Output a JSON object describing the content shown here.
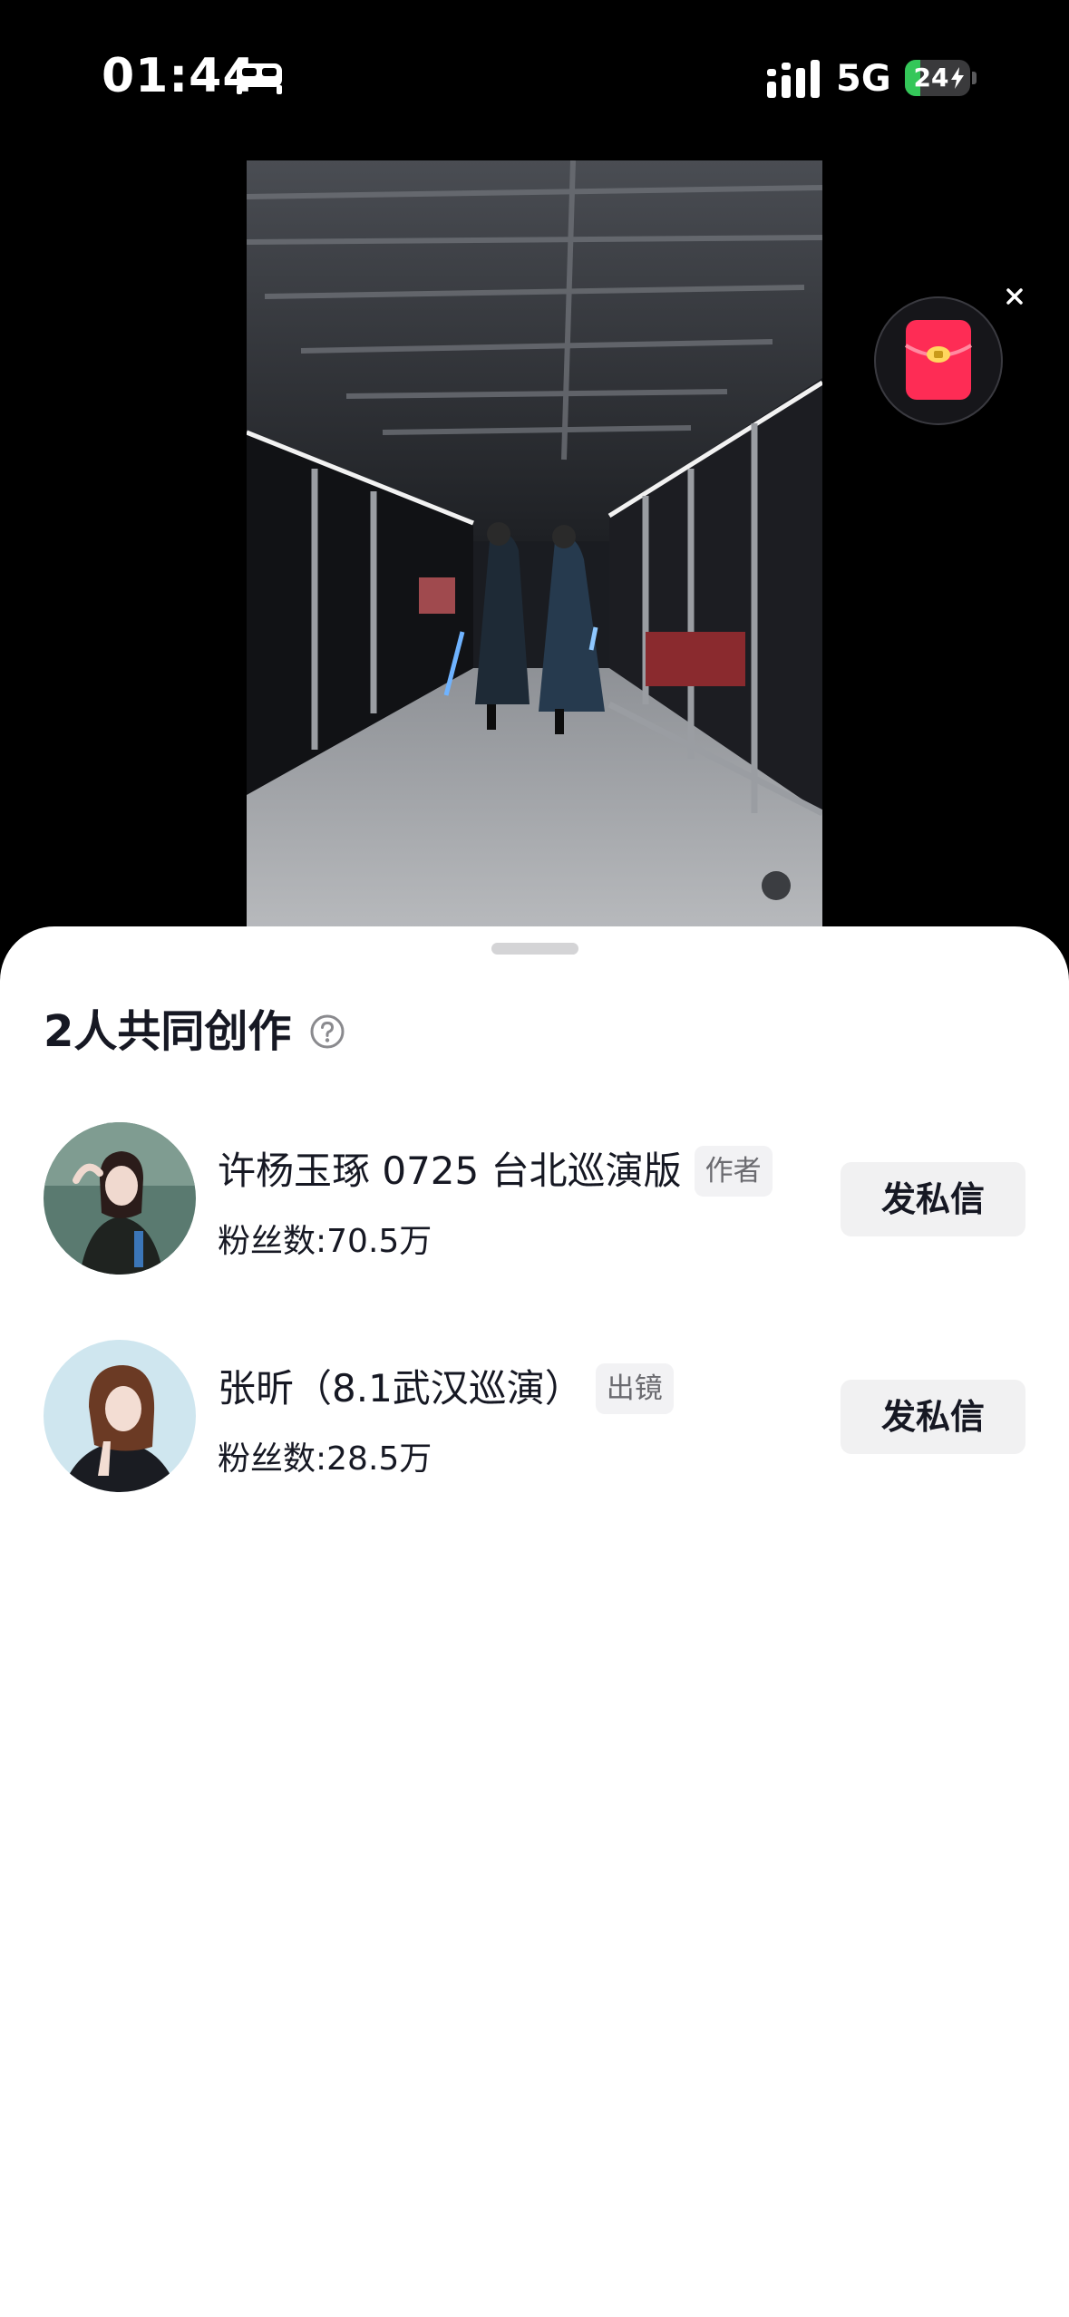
{
  "status_bar": {
    "time": "01:44",
    "network": "5G",
    "battery_level": "24",
    "battery_fraction": 0.24,
    "sleep_icon": "bed-icon",
    "signal_icon": "cellular-signal-icon",
    "charging_icon": "lightning-bolt-icon"
  },
  "video": {
    "icon": "video-player"
  },
  "red_packet": {
    "icon": "red-envelope-icon",
    "close_icon": "close-icon"
  },
  "sheet": {
    "title": "2人共同创作",
    "help_icon": "question-circle-icon",
    "creators": [
      {
        "name": "许杨玉琢 0725 台北巡演版",
        "tag": "作者",
        "fans_label": "粉丝数:",
        "fans_value": "70.5万",
        "button_label": "发私信"
      },
      {
        "name": "张昕（8.1武汉巡演）",
        "tag": "出镜",
        "fans_label": "粉丝数:",
        "fans_value": "28.5万",
        "button_label": "发私信"
      }
    ]
  },
  "colors": {
    "background": "#000000",
    "sheet": "#ffffff",
    "text_primary": "#161823",
    "tag_bg": "#f2f2f4",
    "button_bg": "#f1f1f2",
    "battery_green": "#34c759",
    "red_envelope": "#fe2c55"
  }
}
